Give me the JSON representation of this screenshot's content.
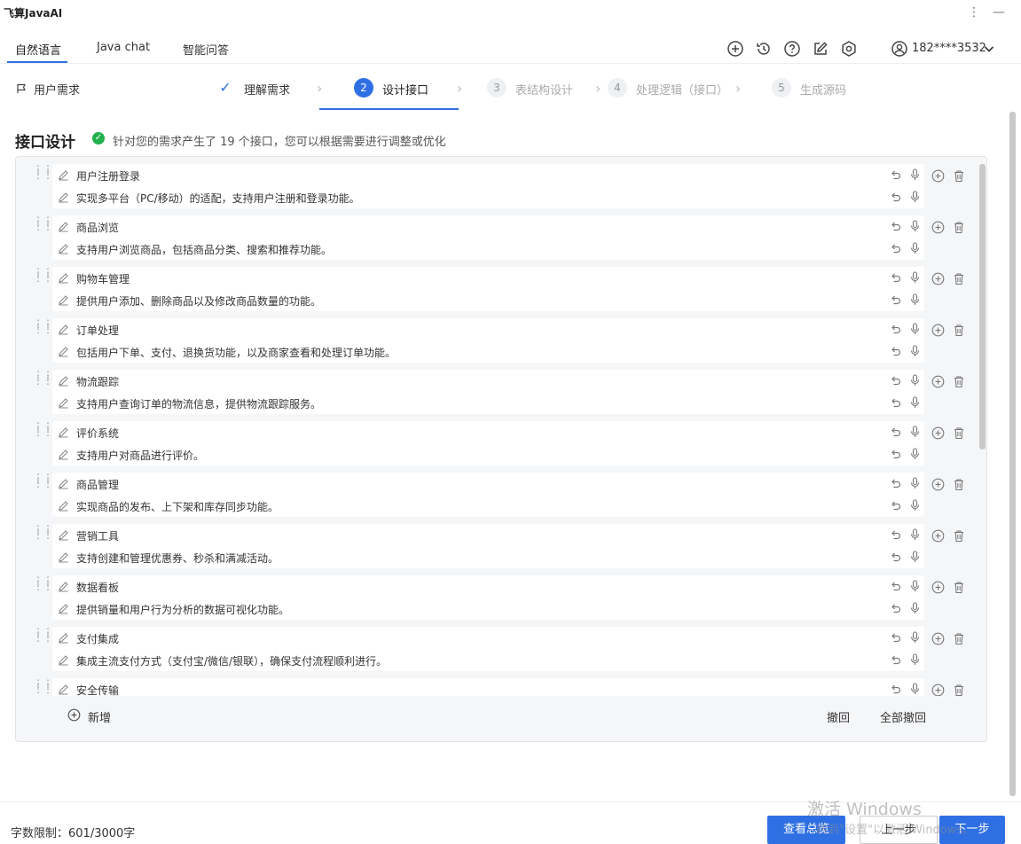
{
  "app": {
    "title": "飞算JavaAI"
  },
  "tabs": [
    {
      "label": "自然语言"
    },
    {
      "label": "Java chat"
    },
    {
      "label": "智能问答"
    }
  ],
  "user": {
    "id": "182****3532"
  },
  "icons": {
    "toolbar": [
      "plus-circle-icon",
      "history-icon",
      "help-icon",
      "edit-icon",
      "settings-icon"
    ],
    "user": "user-avatar-icon"
  },
  "requirement": {
    "label": "用户需求"
  },
  "steps": [
    {
      "num": "✓",
      "label": "理解需求",
      "state": "done"
    },
    {
      "num": "2",
      "label": "设计接口",
      "state": "active"
    },
    {
      "num": "3",
      "label": "表结构设计",
      "state": "pending"
    },
    {
      "num": "4",
      "label": "处理逻辑（接口）",
      "state": "pending"
    },
    {
      "num": "5",
      "label": "生成源码",
      "state": "pending"
    }
  ],
  "section": {
    "title": "接口设计",
    "desc": "针对您的需求产生了 19 个接口，您可以根据需要进行调整或优化"
  },
  "items": [
    {
      "name": "用户注册登录",
      "desc": "实现多平台（PC/移动）的适配，支持用户注册和登录功能。"
    },
    {
      "name": "商品浏览",
      "desc": "支持用户浏览商品，包括商品分类、搜索和推荐功能。"
    },
    {
      "name": "购物车管理",
      "desc": "提供用户添加、删除商品以及修改商品数量的功能。"
    },
    {
      "name": "订单处理",
      "desc": "包括用户下单、支付、退换货功能，以及商家查看和处理订单功能。"
    },
    {
      "name": "物流跟踪",
      "desc": "支持用户查询订单的物流信息，提供物流跟踪服务。"
    },
    {
      "name": "评价系统",
      "desc": "支持用户对商品进行评价。"
    },
    {
      "name": "商品管理",
      "desc": "实现商品的发布、上下架和库存同步功能。"
    },
    {
      "name": "营销工具",
      "desc": "支持创建和管理优惠券、秒杀和满减活动。"
    },
    {
      "name": "数据看板",
      "desc": "提供销量和用户行为分析的数据可视化功能。"
    },
    {
      "name": "支付集成",
      "desc": "集成主流支付方式（支付宝/微信/银联），确保支付流程顺利进行。"
    },
    {
      "name": "安全传输",
      "desc": ""
    }
  ],
  "panel_actions": {
    "add": "新增",
    "undo": "撤回",
    "undo_all": "全部撤回"
  },
  "bottom": {
    "char_limit": "字数限制：601/3000字",
    "overview": "查看总览",
    "prev": "上一步",
    "next": "下一步"
  },
  "watermark": {
    "line1": "激活 Windows",
    "line2": "转到\"设置\"以激活 Windows。"
  },
  "colors": {
    "accent": "#2f6fe4",
    "success": "#22b14c"
  }
}
